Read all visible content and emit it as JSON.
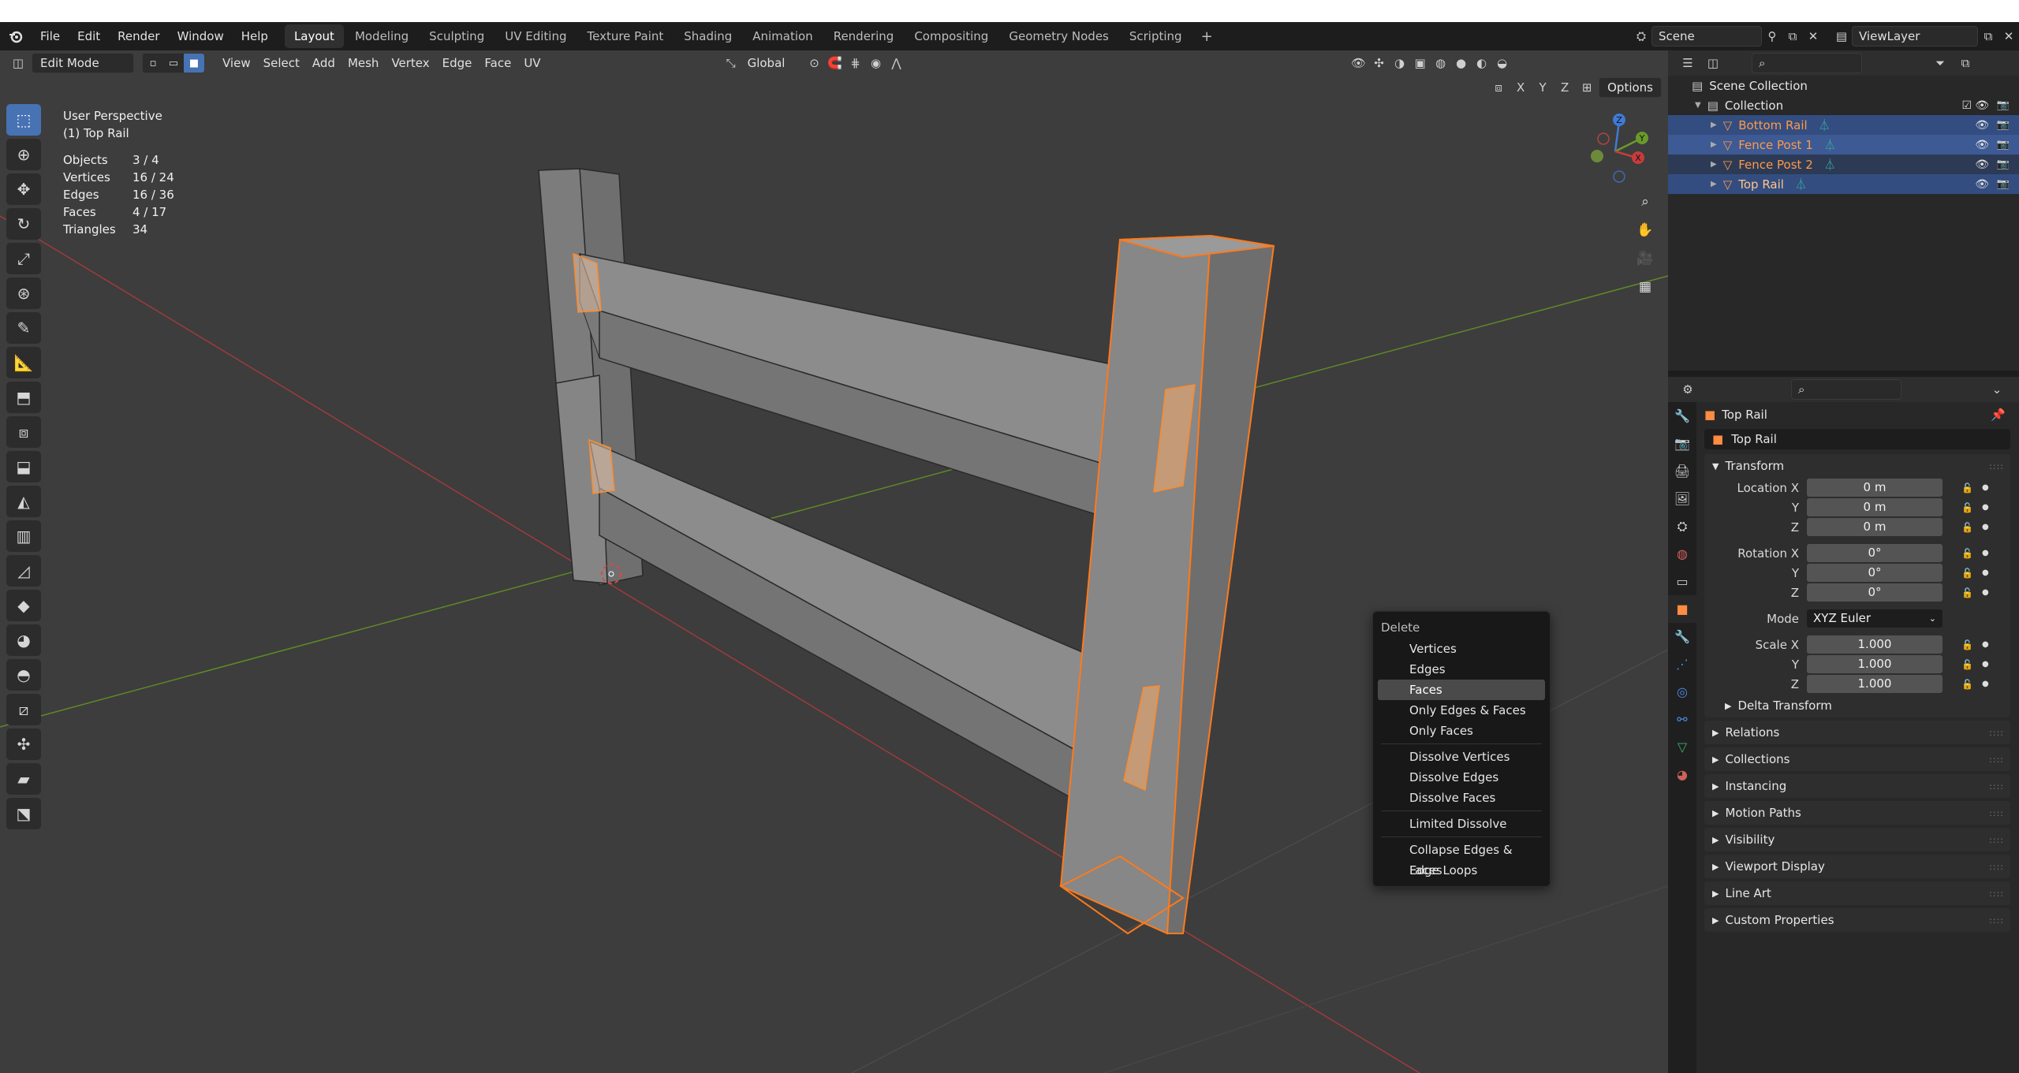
{
  "menubar": {
    "menus": [
      "File",
      "Edit",
      "Render",
      "Window",
      "Help"
    ],
    "workspaces": [
      "Layout",
      "Modeling",
      "Sculpting",
      "UV Editing",
      "Texture Paint",
      "Shading",
      "Animation",
      "Rendering",
      "Compositing",
      "Geometry Nodes",
      "Scripting"
    ],
    "active_workspace": "Layout",
    "add_tab": "+",
    "scene": "Scene",
    "view_layer": "ViewLayer"
  },
  "viewport_header": {
    "mode": "Edit Mode",
    "menus": [
      "View",
      "Select",
      "Add",
      "Mesh",
      "Vertex",
      "Edge",
      "Face",
      "UV"
    ],
    "orientation": "Global",
    "options": "Options",
    "axes": [
      "X",
      "Y",
      "Z"
    ]
  },
  "overlay": {
    "view_name": "User Perspective",
    "object_name": "(1) Top Rail",
    "stats": [
      {
        "label": "Objects",
        "value": "3 / 4"
      },
      {
        "label": "Vertices",
        "value": "16 / 24"
      },
      {
        "label": "Edges",
        "value": "16 / 36"
      },
      {
        "label": "Faces",
        "value": "4 / 17"
      },
      {
        "label": "Triangles",
        "value": "34"
      }
    ]
  },
  "gizmo": {
    "z": "Z",
    "y": "Y",
    "x": "X"
  },
  "delete_menu": {
    "title": "Delete",
    "items": [
      "Vertices",
      "Edges",
      "Faces",
      "Only Edges & Faces",
      "Only Faces",
      "Dissolve Vertices",
      "Dissolve Edges",
      "Dissolve Faces",
      "Limited Dissolve",
      "Collapse Edges & Faces",
      "Edge Loops"
    ],
    "highlighted": "Faces"
  },
  "outliner": {
    "root": "Scene Collection",
    "collection": "Collection",
    "objects": [
      {
        "name": "Bottom Rail",
        "selected": true
      },
      {
        "name": "Fence Post 1",
        "selected": true
      },
      {
        "name": "Fence Post 2",
        "selected": false
      },
      {
        "name": "Top Rail",
        "selected": true
      }
    ]
  },
  "properties": {
    "object_title": "Top Rail",
    "object_name": "Top Rail",
    "transform_label": "Transform",
    "location": [
      {
        "label": "Location X",
        "value": "0 m"
      },
      {
        "label": "Y",
        "value": "0 m"
      },
      {
        "label": "Z",
        "value": "0 m"
      }
    ],
    "rotation": [
      {
        "label": "Rotation X",
        "value": "0°"
      },
      {
        "label": "Y",
        "value": "0°"
      },
      {
        "label": "Z",
        "value": "0°"
      }
    ],
    "mode_label": "Mode",
    "mode_value": "XYZ Euler",
    "scale": [
      {
        "label": "Scale X",
        "value": "1.000"
      },
      {
        "label": "Y",
        "value": "1.000"
      },
      {
        "label": "Z",
        "value": "1.000"
      }
    ],
    "delta_transform": "Delta Transform",
    "panels": [
      "Relations",
      "Collections",
      "Instancing",
      "Motion Paths",
      "Visibility",
      "Viewport Display",
      "Line Art",
      "Custom Properties"
    ]
  },
  "colors": {
    "accent_blue": "#4772b3",
    "selection_orange": "#ff7a1a",
    "object_name_orange": "#ff8c42",
    "x_axis_red": "#c83c3c",
    "y_axis_green": "#6a9a2a"
  }
}
